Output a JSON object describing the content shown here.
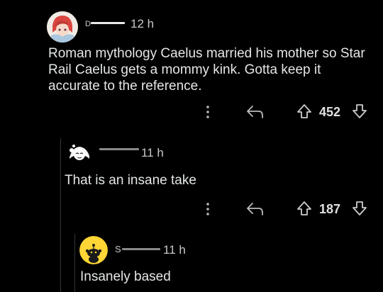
{
  "comments": [
    {
      "username": "D",
      "time": "12 h",
      "body": "Roman mythology Caelus married his mother so Star Rail Caelus gets a mommy kink. Gotta keep it accurate to the reference.",
      "score": "452",
      "icons": [
        "more-icon",
        "reply-icon",
        "upvote-icon",
        "downvote-icon"
      ]
    },
    {
      "username": "",
      "time": "11 h",
      "body": "That is an insane take",
      "score": "187",
      "icons": [
        "more-icon",
        "reply-icon",
        "upvote-icon",
        "downvote-icon"
      ]
    },
    {
      "username": "S",
      "time": "11 h",
      "body": "Insanely based",
      "icons": []
    }
  ],
  "colors": {
    "background": "#000000",
    "text": "#e4e6e8",
    "thread_line": "#343536",
    "snoo_avatar": "#ffd635"
  }
}
